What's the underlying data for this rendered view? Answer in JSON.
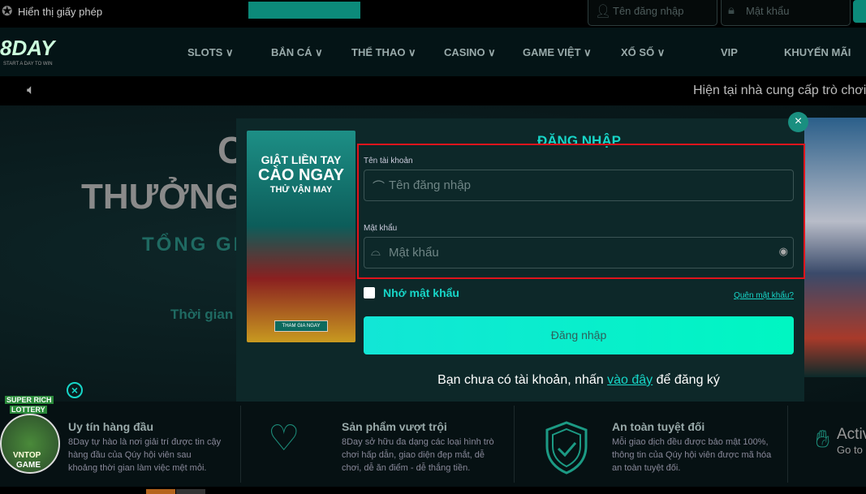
{
  "topbar": {
    "license": "Hiển thị giấy phép",
    "username_placeholder": "Tên đăng nhập",
    "password_placeholder": "Mật khẩu"
  },
  "logo": {
    "text": "8DAY",
    "tagline": "START A DAY TO WIN"
  },
  "nav": [
    {
      "label": "SLOTS ∨"
    },
    {
      "label": "BẮN CÁ ∨"
    },
    {
      "label": "THỂ THAO ∨"
    },
    {
      "label": "CASINO ∨"
    },
    {
      "label": "GAME VIỆT ∨"
    },
    {
      "label": "XỔ SỐ ∨"
    },
    {
      "label": "VIP"
    },
    {
      "label": "KHUYẾN MÃI"
    }
  ],
  "marquee": "Hiện tại nhà cung cấp trò chơi",
  "hero": {
    "line1": "C",
    "line2": "THƯỞNG",
    "line3": "TỔNG GIA",
    "line4": "Thời gian"
  },
  "modal": {
    "title": "ĐĂNG NHẬP",
    "username_label": "Tên tài khoản",
    "username_placeholder": "Tên đăng nhập",
    "password_label": "Mật khẩu",
    "password_placeholder": "Mật khẩu",
    "remember": "Nhớ mật khẩu",
    "forgot": "Quên mật khẩu?",
    "submit": "Đăng nhập",
    "register_prefix": "Bạn chưa có tài khoản, nhấn ",
    "register_link": "vào đây",
    "register_suffix": " để đăng ký",
    "close": "×",
    "banner": {
      "line1": "GIẬT LIỀN TAY",
      "line2": "CÀO NGAY",
      "line3": "THỬ VẬN MAY",
      "cta": "THAM GIA NGAY"
    }
  },
  "features": [
    {
      "title": "Uy tín hàng đầu",
      "desc": "8Day tự hào là nơi giải trí được tin cậy hàng đầu của Qúy hội viên sau khoảng thời gian làm việc mệt mỏi."
    },
    {
      "title": "Sản phẩm vượt trội",
      "desc": "8Day sở hữu đa dạng các loại hình trò chơi hấp dẫn, giao diện đẹp mắt, dễ chơi, dễ ăn điểm - dễ thắng tiền."
    },
    {
      "title": "An toàn tuyệt đối",
      "desc": "Mỗi giao dịch đều được bảo mật 100%, thông tin của Qúy hội viên được mã hóa an toàn tuyệt đối."
    },
    {
      "title": "Activ",
      "desc": "Go to"
    }
  ],
  "lottery": {
    "line1": "SUPER RICH",
    "line2": "LOTTERY",
    "line3": "VNTOP",
    "line4": "GAME"
  },
  "colors": {
    "accent": "#14e8d8",
    "highlight_box": "#e0141c"
  }
}
